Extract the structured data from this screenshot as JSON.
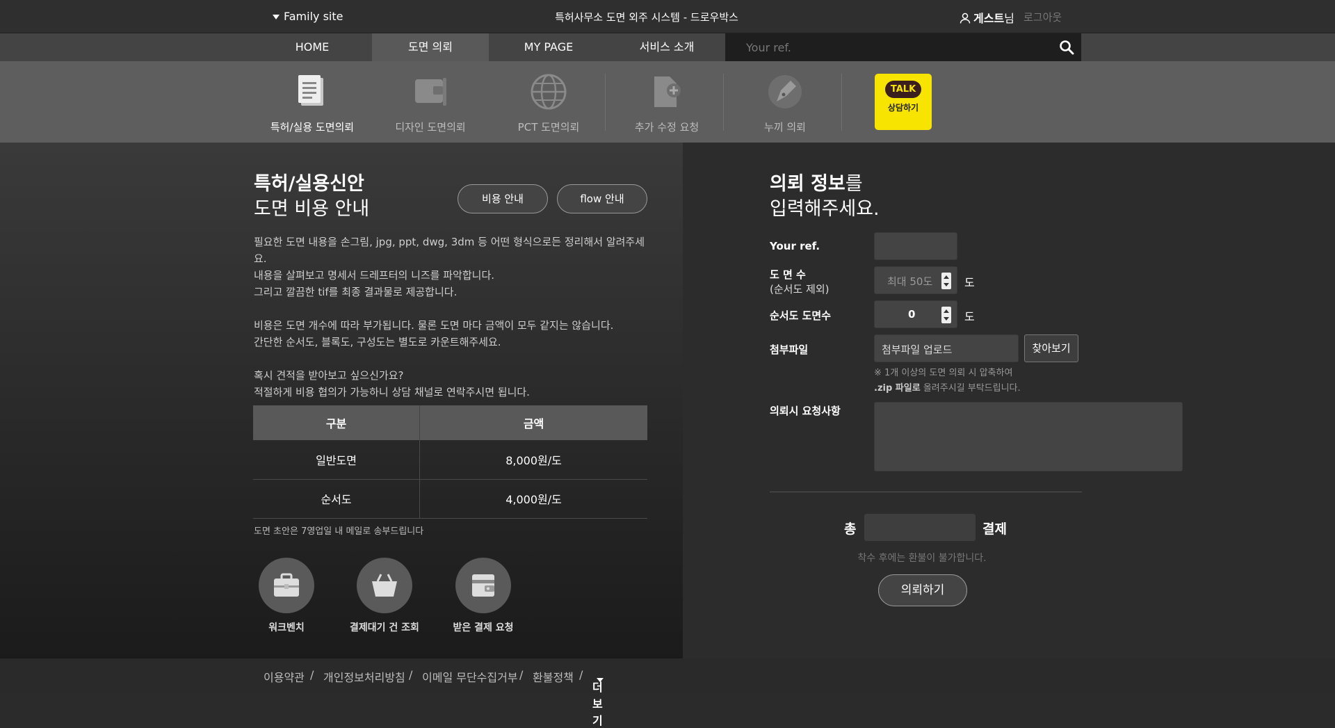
{
  "header": {
    "family_site": "Family site",
    "site_title": "특허사무소 도면 외주 시스템 - 드로우박스",
    "user_name": "게스트",
    "user_suffix": "님",
    "logout": "로그아웃"
  },
  "nav": {
    "items": [
      "HOME",
      "도면 의뢰",
      "MY PAGE",
      "서비스 소개"
    ],
    "search_placeholder": "Your ref."
  },
  "subnav": {
    "items": [
      "특허/실용 도면의뢰",
      "디자인 도면의뢰",
      "PCT 도면의뢰",
      "추가 수정 요청",
      "누끼 의뢰"
    ],
    "talk_bubble": "TALK",
    "talk_label": "상담하기"
  },
  "left": {
    "title_bold": "특허/실용신안",
    "title_light": "도면 비용 안내",
    "btn_cost": "비용 안내",
    "btn_flow": "flow 안내",
    "desc": [
      "필요한 도면 내용을 손그림, jpg, ppt, dwg, 3dm 등 어떤 형식으로든 정리해서 알려주세요.",
      "내용을 살펴보고 명세서 드레프터의 니즈를 파악합니다.",
      "그리고 깔끔한 tif를 최종 결과물로 제공합니다.",
      "비용은 도면 개수에 따라 부가됩니다. 물론 도면 마다 금액이 모두 같지는 않습니다.",
      "간단한 순서도, 블록도, 구성도는 별도로 카운트해주세요.",
      "혹시 견적을 받아보고 싶으신가요?",
      "적절하게 비용 협의가 가능하니 상담 채널로 연락주시면 됩니다."
    ],
    "table": {
      "headers": [
        "구분",
        "금액"
      ],
      "rows": [
        [
          "일반도면",
          "8,000원/도"
        ],
        [
          "순서도",
          "4,000원/도"
        ]
      ]
    },
    "note": "도면 초안은 7영업일 내 메일로 송부드립니다",
    "shortcuts": [
      "워크벤치",
      "결제대기 건 조회",
      "받은 결제 요청"
    ]
  },
  "right": {
    "title_bold": "의뢰 정보",
    "title_tail": "를",
    "title_line2": "입력해주세요.",
    "labels": {
      "ref": "Your ref.",
      "count": "도 면 수",
      "count_sub": "(순서도 제외)",
      "flow_count": "순서도 도면수",
      "attach": "첨부파일",
      "request": "의뢰시 요청사항"
    },
    "count_placeholder": "최대 50도",
    "flow_value": "0",
    "unit": "도",
    "attach_placeholder": "첨부파일 업로드",
    "browse": "찾아보기",
    "hint1": "※ 1개 이상의 도면 의뢰 시 압축하여",
    "hint2_bold": ".zip 파일로",
    "hint2_rest": " 올려주시길 부탁드립니다.",
    "total_prefix": "총",
    "total_suffix": "결제",
    "refund_notice": "착수 후에는 환불이 불가합니다.",
    "submit": "의뢰하기"
  },
  "footer": {
    "links": [
      "이용약관",
      "개인정보처리방침",
      "이메일 무단수집거부",
      "환불정책"
    ],
    "separator": "/",
    "more": "더보기"
  }
}
